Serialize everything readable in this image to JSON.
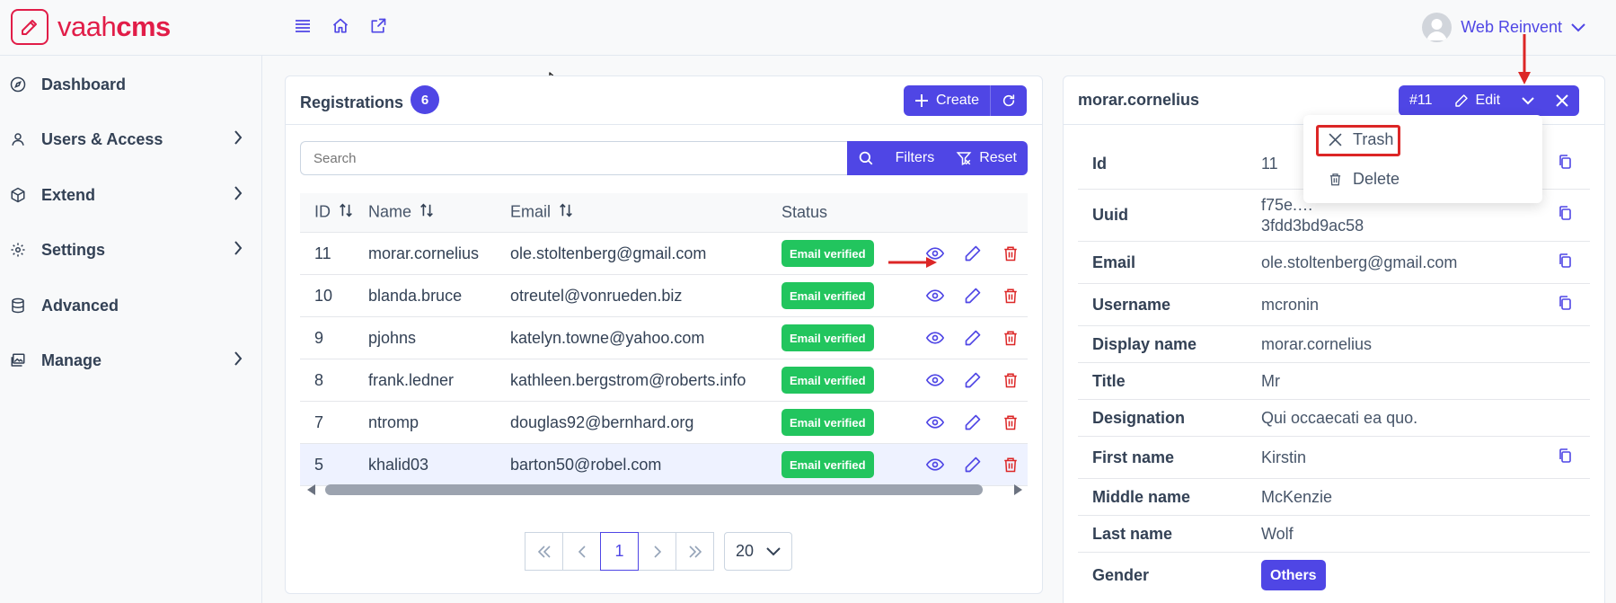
{
  "brand": {
    "name_light": "vaah",
    "name_bold": "cms"
  },
  "topbar": {
    "icons": [
      "menu-icon",
      "home-icon",
      "external-link-icon"
    ],
    "user_name": "Web Reinvent"
  },
  "sidebar": {
    "items": [
      {
        "label": "Dashboard",
        "icon": "compass-icon",
        "has_children": false
      },
      {
        "label": "Users & Access",
        "icon": "user-icon",
        "has_children": true
      },
      {
        "label": "Extend",
        "icon": "cube-icon",
        "has_children": true
      },
      {
        "label": "Settings",
        "icon": "gear-icon",
        "has_children": true
      },
      {
        "label": "Advanced",
        "icon": "database-icon",
        "has_children": false
      },
      {
        "label": "Manage",
        "icon": "images-icon",
        "has_children": true
      }
    ]
  },
  "list": {
    "title": "Registrations",
    "count": "6",
    "create_label": "Create",
    "search_placeholder": "Search",
    "filters_label": "Filters",
    "reset_label": "Reset",
    "columns": {
      "id": "ID",
      "name": "Name",
      "email": "Email",
      "status": "Status"
    },
    "rows": [
      {
        "id": "11",
        "name": "morar.cornelius",
        "email": "ole.stoltenberg@gmail.com",
        "status": "Email verified"
      },
      {
        "id": "10",
        "name": "blanda.bruce",
        "email": "otreutel@vonrueden.biz",
        "status": "Email verified"
      },
      {
        "id": "9",
        "name": "pjohns",
        "email": "katelyn.towne@yahoo.com",
        "status": "Email verified"
      },
      {
        "id": "8",
        "name": "frank.ledner",
        "email": "kathleen.bergstrom@roberts.info",
        "status": "Email verified"
      },
      {
        "id": "7",
        "name": "ntromp",
        "email": "douglas92@bernhard.org",
        "status": "Email verified"
      },
      {
        "id": "5",
        "name": "khalid03",
        "email": "barton50@robel.com",
        "status": "Email verified"
      }
    ],
    "pagination": {
      "current_page": "1",
      "per_page": "20"
    }
  },
  "detail": {
    "title": "morar.cornelius",
    "id_badge": "#11",
    "edit_label": "Edit",
    "dropdown": {
      "trash_label": "Trash",
      "delete_label": "Delete"
    },
    "fields": [
      {
        "label": "Id",
        "value": "11"
      },
      {
        "label": "Uuid",
        "value": "f75e.… 3fdd3bd9ac58"
      },
      {
        "label": "Email",
        "value": "ole.stoltenberg@gmail.com"
      },
      {
        "label": "Username",
        "value": "mcronin"
      },
      {
        "label": "Display name",
        "value": "morar.cornelius"
      },
      {
        "label": "Title",
        "value": "Mr"
      },
      {
        "label": "Designation",
        "value": "Qui occaecati ea quo."
      },
      {
        "label": "First name",
        "value": "Kirstin"
      },
      {
        "label": "Middle name",
        "value": "McKenzie"
      },
      {
        "label": "Last name",
        "value": "Wolf"
      },
      {
        "label": "Gender",
        "value": "Others"
      }
    ]
  },
  "colors": {
    "primary": "#4f46e5",
    "brand": "#e11d48",
    "success": "#22c55e",
    "danger": "#dc2626"
  }
}
